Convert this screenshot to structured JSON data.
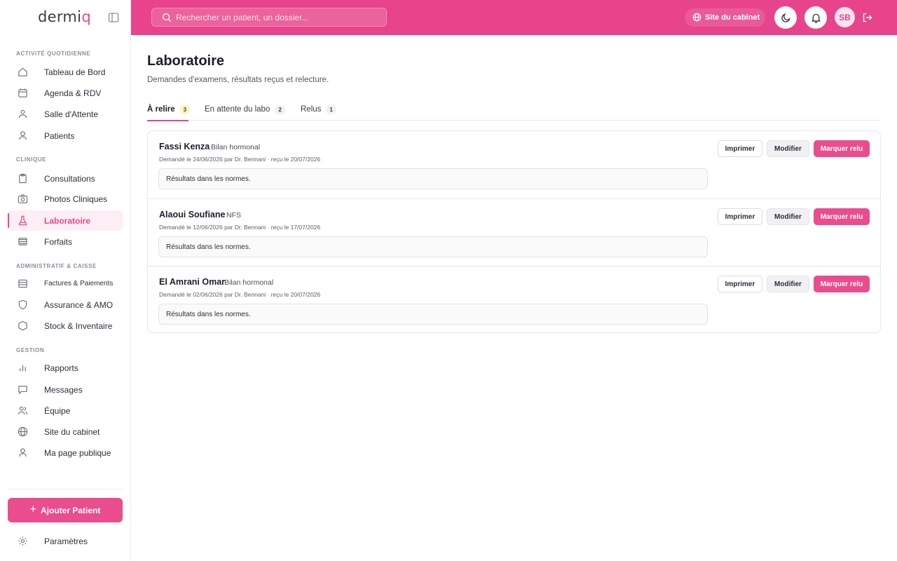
{
  "app": {
    "logo_main": "dermi",
    "logo_accent": "q"
  },
  "topbar": {
    "search_placeholder": "Rechercher un patient, un dossier...",
    "site_label": "Site du cabinet",
    "avatar_initials": "SB"
  },
  "sidebar": {
    "sections": {
      "daily": "ACTIVITÉ QUOTIDIENNE",
      "clinical": "CLINIQUE",
      "admin": "ADMINISTRATIF & CAISSE",
      "management": "GESTION"
    },
    "items": {
      "dashboard": "Tableau de Bord",
      "agenda": "Agenda & RDV",
      "waiting": "Salle d'Attente",
      "patients": "Patients",
      "consultations": "Consultations",
      "photos": "Photos Cliniques",
      "lab": "Laboratoire",
      "packages": "Forfaits",
      "invoices": "Factures & Paiements",
      "insurance": "Assurance & AMO",
      "stock": "Stock & Inventaire",
      "reports": "Rapports",
      "messages": "Messages",
      "team": "Équipe",
      "site": "Site du cabinet",
      "public_page": "Ma page publique"
    },
    "add_patient": "Ajouter Patient",
    "settings": "Paramètres"
  },
  "main": {
    "title": "Laboratoire",
    "subtitle": "Demandes d'examens, résultats reçus et relecture.",
    "tabs": [
      {
        "label": "À relire",
        "count": "3"
      },
      {
        "label": "En attente du labo",
        "count": "2"
      },
      {
        "label": "Relus",
        "count": "1"
      }
    ],
    "rows": [
      {
        "name": "Fassi Kenza",
        "exam": "Bilan hormonal",
        "meta": "Demandé le 24/06/2026 par Dr. Bennani · reçu le 20/07/2026",
        "result": "Résultats dans les normes."
      },
      {
        "name": "Alaoui Soufiane",
        "exam": "NFS",
        "meta": "Demandé le 12/06/2026 par Dr. Bennani · reçu le 17/07/2026",
        "result": "Résultats dans les normes."
      },
      {
        "name": "El Amrani Omar",
        "exam": "Bilan hormonal",
        "meta": "Demandé le 02/06/2026 par Dr. Bennani · reçu le 20/07/2026",
        "result": "Résultats dans les normes."
      }
    ],
    "actions": {
      "print": "Imprimer",
      "edit": "Modifier",
      "mark_read": "Marquer relu"
    }
  },
  "colors": {
    "accent": "#e8448b",
    "active_bg": "#fdeef5",
    "count_active_bg": "#fdf2c6"
  }
}
